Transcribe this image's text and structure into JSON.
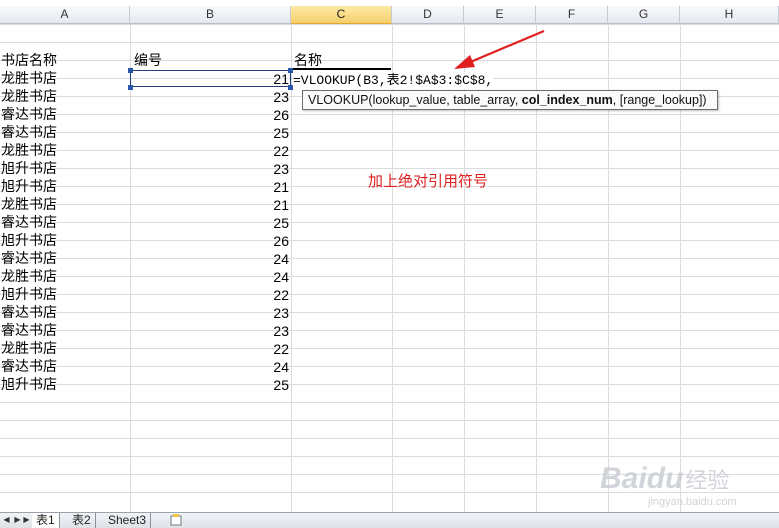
{
  "columns": [
    "A",
    "B",
    "C",
    "D",
    "E",
    "F",
    "G",
    "H"
  ],
  "active_column": "C",
  "headers": {
    "a": "书店名称",
    "b": "编号",
    "c": "名称"
  },
  "rows": [
    {
      "store": "龙胜书店",
      "num": "21"
    },
    {
      "store": "龙胜书店",
      "num": "23"
    },
    {
      "store": "睿达书店",
      "num": "26"
    },
    {
      "store": "睿达书店",
      "num": "25"
    },
    {
      "store": "龙胜书店",
      "num": "22"
    },
    {
      "store": "旭升书店",
      "num": "23"
    },
    {
      "store": "旭升书店",
      "num": "21"
    },
    {
      "store": "龙胜书店",
      "num": "21"
    },
    {
      "store": "睿达书店",
      "num": "25"
    },
    {
      "store": "旭升书店",
      "num": "26"
    },
    {
      "store": "睿达书店",
      "num": "24"
    },
    {
      "store": "龙胜书店",
      "num": "24"
    },
    {
      "store": "旭升书店",
      "num": "22"
    },
    {
      "store": "睿达书店",
      "num": "23"
    },
    {
      "store": "睿达书店",
      "num": "23"
    },
    {
      "store": "龙胜书店",
      "num": "22"
    },
    {
      "store": "睿达书店",
      "num": "24"
    },
    {
      "store": "旭升书店",
      "num": "25"
    }
  ],
  "formula": "=VLOOKUP(B3,表2!$A$3:$C$8,",
  "tooltip": {
    "prefix": "VLOOKUP(lookup_value, table_array, ",
    "bold_arg": "col_index_num",
    "suffix": ", [range_lookup])"
  },
  "annotation": "加上绝对引用符号",
  "sheet_tabs": [
    "表1",
    "表2",
    "Sheet3"
  ],
  "active_tab": "表1",
  "watermark": {
    "logo": "Baidu",
    "text": "经验",
    "url": "jingyan.baidu.com"
  },
  "colors": {
    "annotation": "#e02020",
    "arrow": "#e02020",
    "active_header": "#f6cf6b",
    "selection": "#1f3e7a"
  }
}
